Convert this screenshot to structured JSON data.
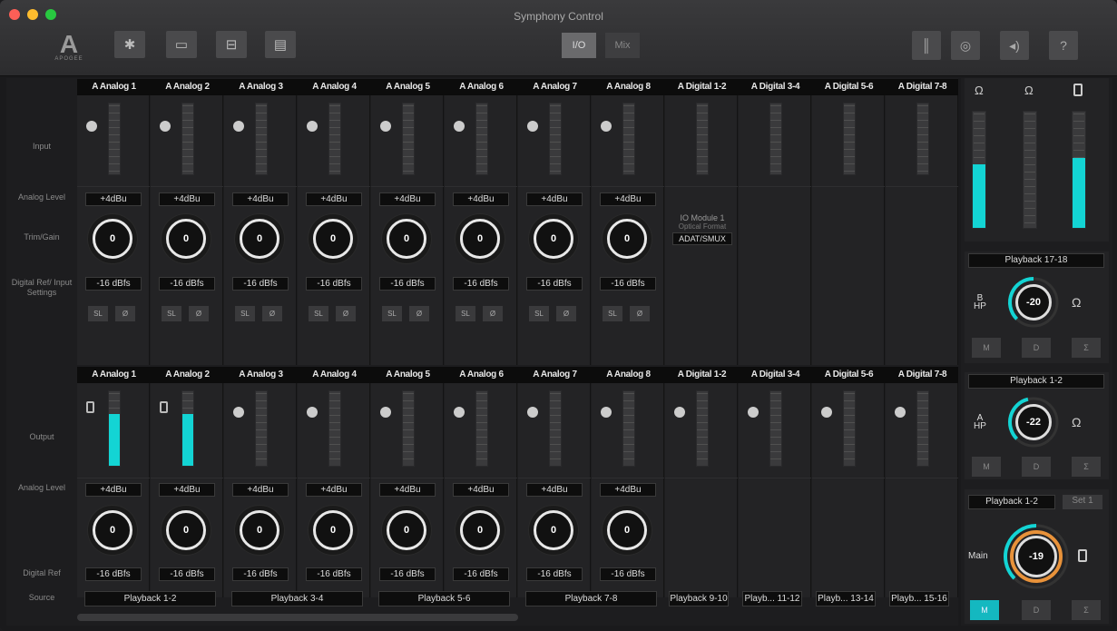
{
  "window": {
    "title": "Symphony Control"
  },
  "toolbar": {
    "logo_text": "APOGEE",
    "view_segments": [
      "I/O",
      "Mix"
    ],
    "left_icons": [
      "gear-icon",
      "device-icon",
      "module-icon",
      "rack-icon"
    ],
    "right_icons": [
      "meters-icon",
      "mic-icon",
      "speaker-icon",
      "help-icon"
    ],
    "help_glyph": "?"
  },
  "row_labels": {
    "input": "Input",
    "analog_level": "Analog Level",
    "trim_gain": "Trim/Gain",
    "digital_ref_input": "Digital Ref/ Input Settings",
    "output": "Output",
    "out_analog_level": "Analog Level",
    "digital_ref": "Digital Ref",
    "source": "Source"
  },
  "input_channels": [
    {
      "name": "A Analog 1",
      "level": "+4dBu",
      "gain": "0",
      "ref": "-16 dBfs"
    },
    {
      "name": "A Analog 2",
      "level": "+4dBu",
      "gain": "0",
      "ref": "-16 dBfs"
    },
    {
      "name": "A Analog 3",
      "level": "+4dBu",
      "gain": "0",
      "ref": "-16 dBfs"
    },
    {
      "name": "A Analog 4",
      "level": "+4dBu",
      "gain": "0",
      "ref": "-16 dBfs"
    },
    {
      "name": "A Analog 5",
      "level": "+4dBu",
      "gain": "0",
      "ref": "-16 dBfs"
    },
    {
      "name": "A Analog 6",
      "level": "+4dBu",
      "gain": "0",
      "ref": "-16 dBfs"
    },
    {
      "name": "A Analog 7",
      "level": "+4dBu",
      "gain": "0",
      "ref": "-16 dBfs"
    },
    {
      "name": "A Analog 8",
      "level": "+4dBu",
      "gain": "0",
      "ref": "-16 dBfs"
    },
    {
      "name": "A Digital 1-2"
    },
    {
      "name": "A Digital 3-4"
    },
    {
      "name": "A Digital 5-6"
    },
    {
      "name": "A Digital 7-8"
    }
  ],
  "input_buttons": {
    "sl": "SL",
    "phase": "Ø"
  },
  "io_module": {
    "title": "IO Module 1",
    "subtitle": "Optical Format",
    "value": "ADAT/SMUX"
  },
  "output_channels": [
    {
      "name": "A Analog 1",
      "level": "+4dBu",
      "gain": "0",
      "ref": "-16 dBfs",
      "meter": 0.7
    },
    {
      "name": "A Analog 2",
      "level": "+4dBu",
      "gain": "0",
      "ref": "-16 dBfs",
      "meter": 0.7
    },
    {
      "name": "A Analog 3",
      "level": "+4dBu",
      "gain": "0",
      "ref": "-16 dBfs",
      "meter": 0
    },
    {
      "name": "A Analog 4",
      "level": "+4dBu",
      "gain": "0",
      "ref": "-16 dBfs",
      "meter": 0
    },
    {
      "name": "A Analog 5",
      "level": "+4dBu",
      "gain": "0",
      "ref": "-16 dBfs",
      "meter": 0
    },
    {
      "name": "A Analog 6",
      "level": "+4dBu",
      "gain": "0",
      "ref": "-16 dBfs",
      "meter": 0
    },
    {
      "name": "A Analog 7",
      "level": "+4dBu",
      "gain": "0",
      "ref": "-16 dBfs",
      "meter": 0
    },
    {
      "name": "A Analog 8",
      "level": "+4dBu",
      "gain": "0",
      "ref": "-16 dBfs",
      "meter": 0
    },
    {
      "name": "A Digital 1-2",
      "meter": 0
    },
    {
      "name": "A Digital 3-4",
      "meter": 0
    },
    {
      "name": "A Digital 5-6",
      "meter": 0
    },
    {
      "name": "A Digital 7-8",
      "meter": 0
    }
  ],
  "sources": [
    "Playback 1-2",
    "Playback 3-4",
    "Playback 5-6",
    "Playback 7-8",
    "Playback 9-10",
    "Playb... 11-12",
    "Playb... 13-14",
    "Playb... 15-16"
  ],
  "side": {
    "meter_levels": [
      0.55,
      0,
      0.6
    ],
    "hp_b": {
      "source": "Playback 17-18",
      "label": "B",
      "sublabel": "HP",
      "value": "-20",
      "ring": 0.5
    },
    "hp_a": {
      "source": "Playback 1-2",
      "label": "A",
      "sublabel": "HP",
      "value": "-22",
      "ring": 0.45
    },
    "main": {
      "source": "Playback 1-2",
      "set": "Set 1",
      "label": "Main",
      "value": "-19",
      "ring": 0.5
    },
    "buttons": [
      "M",
      "D",
      "Σ"
    ]
  },
  "colors": {
    "accent": "#13d4d4",
    "main_ring": "#e8923a"
  }
}
